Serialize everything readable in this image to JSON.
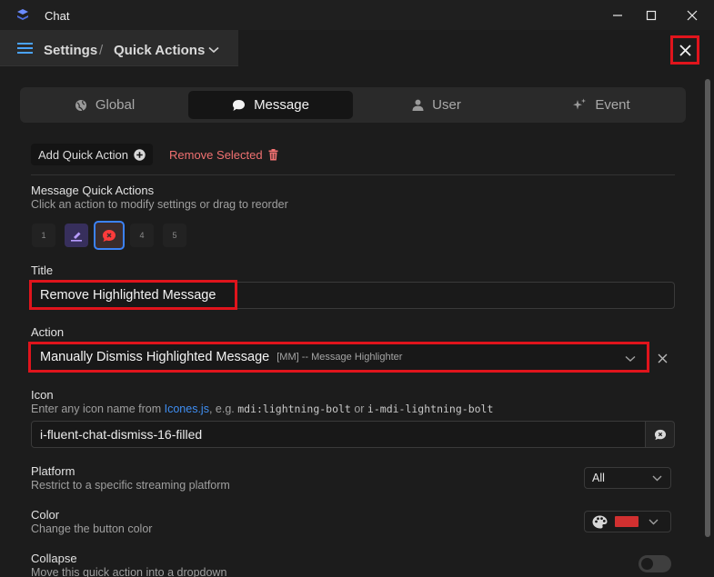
{
  "window": {
    "title": "Chat"
  },
  "header": {
    "crumb_root": "Settings",
    "separator": "/",
    "crumb_current": "Quick Actions"
  },
  "tabs": [
    {
      "label": "Global",
      "icon": "globe-icon"
    },
    {
      "label": "Message",
      "icon": "chat-bubble-icon",
      "active": true
    },
    {
      "label": "User",
      "icon": "user-icon"
    },
    {
      "label": "Event",
      "icon": "sparkle-icon"
    }
  ],
  "toolbar": {
    "add_label": "Add Quick Action",
    "remove_label": "Remove Selected"
  },
  "quick_actions": {
    "title": "Message Quick Actions",
    "hint": "Click an action to modify settings or drag to reorder",
    "slots": [
      "1",
      "",
      "",
      "4",
      "5"
    ],
    "selected_index": 2
  },
  "title_field": {
    "label": "Title",
    "value": "Remove Highlighted Message"
  },
  "action_field": {
    "label": "Action",
    "value": "Manually Dismiss Highlighted Message",
    "detail": "[MM] -- Message Highlighter"
  },
  "icon_field": {
    "label": "Icon",
    "hint_prefix": "Enter any icon name from ",
    "hint_link": "Icones.js",
    "hint_mid": ", e.g. ",
    "hint_code1": "mdi:lightning-bolt",
    "hint_or": " or ",
    "hint_code2": "i-mdi-lightning-bolt",
    "value": "i-fluent-chat-dismiss-16-filled"
  },
  "platform": {
    "label": "Platform",
    "hint": "Restrict to a specific streaming platform",
    "value": "All"
  },
  "color": {
    "label": "Color",
    "hint": "Change the button color",
    "value": "#d13030"
  },
  "collapse": {
    "label": "Collapse",
    "hint": "Move this quick action into a dropdown",
    "enabled": false
  },
  "colors": {
    "accent_highlight": "#e0141c",
    "selection_border": "#3b82f6",
    "link": "#3f8ef2",
    "danger_text": "#f07171"
  }
}
